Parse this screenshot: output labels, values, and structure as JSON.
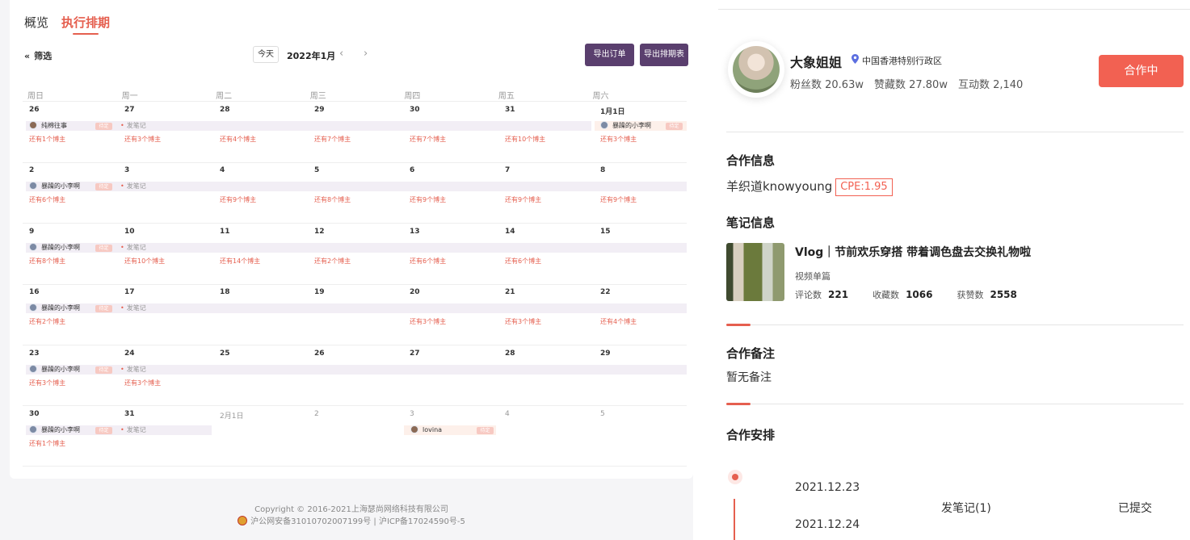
{
  "tabs": [
    "概览",
    "执行排期"
  ],
  "toolbar": {
    "filter_label": "筛选",
    "today_label": "今天",
    "month_label": "2022年1月",
    "export_orders_label": "导出订单",
    "export_schedule_label": "导出排期表"
  },
  "calendar": {
    "weekday_headers": [
      "周日",
      "周一",
      "周二",
      "周三",
      "周四",
      "周五",
      "周六"
    ],
    "weeks": [
      {
        "days": [
          "26",
          "27",
          "28",
          "29",
          "30",
          "31",
          "1月1日"
        ],
        "bars": [
          {
            "blogger": "纯棉往事",
            "tag": "待定",
            "note": "发笔记"
          },
          {
            "blogger": "暴躁的小李啊",
            "tag": "待定"
          }
        ],
        "remaining": [
          "还有1个博主",
          "还有3个博主",
          "还有4个博主",
          "还有7个博主",
          "还有7个博主",
          "还有10个博主",
          "还有3个博主"
        ]
      },
      {
        "days": [
          "2",
          "3",
          "4",
          "5",
          "6",
          "7",
          "8"
        ],
        "bars": [
          {
            "blogger": "暴躁的小李啊",
            "tag": "待定",
            "note": "发笔记"
          }
        ],
        "remaining": [
          "还有6个博主",
          "",
          "还有9个博主",
          "还有8个博主",
          "还有9个博主",
          "还有9个博主",
          "还有9个博主"
        ]
      },
      {
        "days": [
          "9",
          "10",
          "11",
          "12",
          "13",
          "14",
          "15"
        ],
        "bars": [
          {
            "blogger": "暴躁的小李啊",
            "tag": "待定",
            "note": "发笔记"
          }
        ],
        "remaining": [
          "还有8个博主",
          "还有10个博主",
          "还有14个博主",
          "还有2个博主",
          "还有6个博主",
          "还有6个博主",
          ""
        ]
      },
      {
        "days": [
          "16",
          "17",
          "18",
          "19",
          "20",
          "21",
          "22"
        ],
        "bars": [
          {
            "blogger": "暴躁的小李啊",
            "tag": "待定",
            "note": "发笔记"
          }
        ],
        "remaining": [
          "还有2个博主",
          "",
          "",
          "",
          "还有3个博主",
          "还有3个博主",
          "还有4个博主"
        ]
      },
      {
        "days": [
          "23",
          "24",
          "25",
          "26",
          "27",
          "28",
          "29"
        ],
        "bars": [
          {
            "blogger": "暴躁的小李啊",
            "tag": "待定",
            "note": "发笔记"
          }
        ],
        "remaining": [
          "还有3个博主",
          "还有3个博主",
          "",
          "",
          "",
          "",
          ""
        ]
      },
      {
        "days": [
          "30",
          "31",
          "2月1日",
          "2",
          "3",
          "4",
          "5"
        ],
        "bars": [
          {
            "blogger": "暴躁的小李啊",
            "tag": "待定",
            "note": "发笔记"
          },
          {
            "blogger": "lovina",
            "tag": "待定"
          }
        ],
        "remaining": [
          "还有1个博主",
          "",
          "",
          "",
          "",
          "",
          ""
        ]
      }
    ]
  },
  "footer": {
    "copyright": "Copyright © 2016-2021上海瑟尚网络科技有限公司",
    "icp": "沪公网安备31010702007199号 | 沪ICP备17024590号-5"
  },
  "profile": {
    "name": "大象姐姐",
    "location": "中国香港特别行政区",
    "fans": "粉丝数 20.63w",
    "likes_collects": "赞藏数 27.80w",
    "interactions": "互动数 2,140",
    "status_button": "合作中"
  },
  "cooperation": {
    "title": "合作信息",
    "brand": "羊织道knowyoung",
    "cpe": "CPE:1.95"
  },
  "note_info": {
    "title": "笔记信息",
    "note_title": "Vlog｜节前欢乐穿搭 带着调色盘去交换礼物啦",
    "type": "视频单篇",
    "comments_label": "评论数",
    "comments": "221",
    "collects_label": "收藏数",
    "collects": "1066",
    "likes_label": "获赞数",
    "likes": "2558"
  },
  "remarks": {
    "title": "合作备注",
    "text": "暂无备注"
  },
  "arrangement": {
    "title": "合作安排",
    "date_start": "2021.12.23",
    "date_end": "2021.12.24",
    "task": "发笔记(1)",
    "status": "已提交"
  },
  "colors": {
    "accent": "#e55f4f",
    "button_dark": "#5a3f6e",
    "status_button": "#f26152"
  }
}
